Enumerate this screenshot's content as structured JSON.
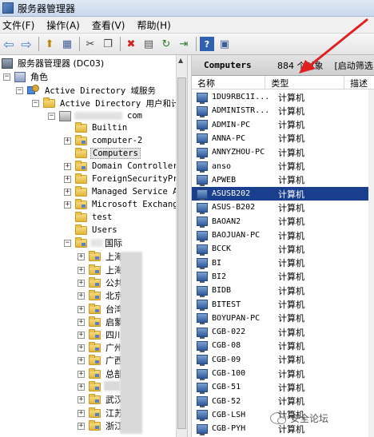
{
  "window": {
    "title": "服务器管理器"
  },
  "menu": [
    "文件(F)",
    "操作(A)",
    "查看(V)",
    "帮助(H)"
  ],
  "toolbar": {
    "icons": [
      "back-icon",
      "forward-icon",
      "folder-up-icon",
      "show-tree-icon",
      "cut-icon",
      "copy-icon",
      "delete-icon",
      "properties-icon",
      "refresh-icon",
      "export-icon",
      "help-icon",
      "mmc-icon"
    ],
    "glyphs": {
      "back": "⇦",
      "forward": "⇨",
      "up": "⬆",
      "tree": "▦",
      "cut": "✂",
      "copy": "❐",
      "delete": "✖",
      "properties": "▤",
      "refresh": "↻",
      "export": "⇥",
      "help": "?",
      "mmc": "▣"
    },
    "delete_color": "#d42020"
  },
  "tree": {
    "root": "服务器管理器 (DC03)",
    "roles": "角色",
    "adds": "Active Directory 域服务",
    "aduc": "Active Directory 用户和计",
    "domain_suffix": "com",
    "containers": [
      "Builtin",
      "computer-2",
      "Computers",
      "Domain Controllers",
      "ForeignSecurityPri",
      "Managed Service Ac",
      "Microsoft Exchange",
      "test",
      "Users"
    ],
    "ou": "国际",
    "sub_ous": [
      "上海",
      "上海",
      "公共",
      "北京",
      "台湾",
      "启蒙",
      "四川",
      "广州",
      "广西",
      "总部",
      "",
      "武汉",
      "江苏",
      "浙江"
    ]
  },
  "content": {
    "title": "Computers",
    "count": "884 个对象",
    "filter": "[启动筛选",
    "columns": [
      "名称",
      "类型",
      "描述"
    ],
    "rows": [
      {
        "name": "1DU9RBC1I...",
        "type": "计算机"
      },
      {
        "name": "ADMINISTR...",
        "type": "计算机"
      },
      {
        "name": "ADMIN-PC",
        "type": "计算机"
      },
      {
        "name": "ANNA-PC",
        "type": "计算机"
      },
      {
        "name": "ANNYZHOU-PC",
        "type": "计算机"
      },
      {
        "name": "anso",
        "type": "计算机"
      },
      {
        "name": "APWEB",
        "type": "计算机"
      },
      {
        "name": "ASUSB202",
        "type": "计算机"
      },
      {
        "name": "ASUS-B202",
        "type": "计算机"
      },
      {
        "name": "BAOAN2",
        "type": "计算机"
      },
      {
        "name": "BAOJUAN-PC",
        "type": "计算机"
      },
      {
        "name": "BCCK",
        "type": "计算机"
      },
      {
        "name": "BI",
        "type": "计算机"
      },
      {
        "name": "BI2",
        "type": "计算机"
      },
      {
        "name": "BIDB",
        "type": "计算机"
      },
      {
        "name": "BITEST",
        "type": "计算机"
      },
      {
        "name": "BOYUPAN-PC",
        "type": "计算机"
      },
      {
        "name": "CGB-022",
        "type": "计算机"
      },
      {
        "name": "CGB-08",
        "type": "计算机"
      },
      {
        "name": "CGB-09",
        "type": "计算机"
      },
      {
        "name": "CGB-100",
        "type": "计算机"
      },
      {
        "name": "CGB-51",
        "type": "计算机"
      },
      {
        "name": "CGB-52",
        "type": "计算机"
      },
      {
        "name": "CGB-LSH",
        "type": "计算机"
      },
      {
        "name": "CGB-PYH",
        "type": "计算机"
      }
    ],
    "selected_row": "ASUSB202"
  },
  "annotation": {
    "color": "#e02020"
  },
  "watermark": {
    "text": "安全论坛"
  }
}
